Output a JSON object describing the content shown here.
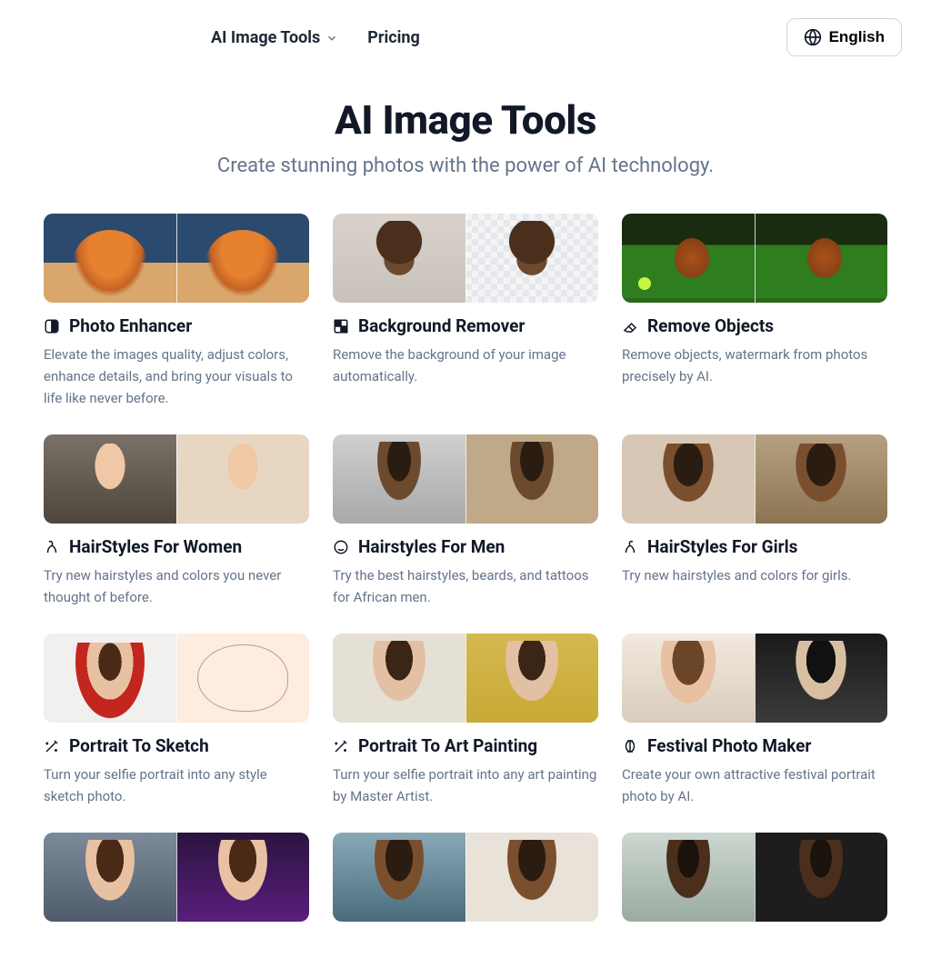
{
  "nav": {
    "tools": "AI Image Tools",
    "pricing": "Pricing",
    "language": "English"
  },
  "hero": {
    "title": "AI Image Tools",
    "subtitle": "Create stunning photos with the power of AI technology."
  },
  "cards": [
    {
      "title": "Photo Enhancer",
      "desc": "Elevate the images quality, adjust colors, enhance details, and bring your visuals to life like never before."
    },
    {
      "title": "Background Remover",
      "desc": "Remove the background of your image automatically."
    },
    {
      "title": "Remove Objects",
      "desc": "Remove objects, watermark from photos precisely by AI."
    },
    {
      "title": "HairStyles For Women",
      "desc": "Try new hairstyles and colors you never thought of before."
    },
    {
      "title": "Hairstyles For Men",
      "desc": "Try the best hairstyles, beards, and tattoos for African men."
    },
    {
      "title": "HairStyles For Girls",
      "desc": "Try new hairstyles and colors for girls."
    },
    {
      "title": "Portrait To Sketch",
      "desc": "Turn your selfie portrait into any style sketch photo."
    },
    {
      "title": "Portrait To Art Painting",
      "desc": "Turn your selfie portrait into any art painting by Master Artist."
    },
    {
      "title": "Festival Photo Maker",
      "desc": "Create your own attractive festival portrait photo by AI."
    }
  ]
}
